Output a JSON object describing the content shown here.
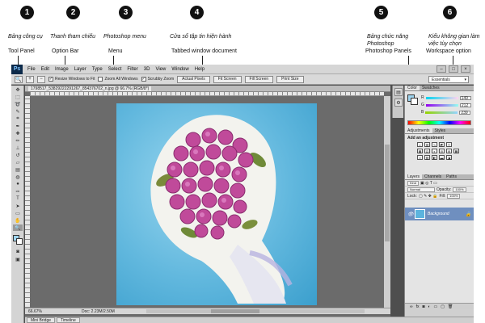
{
  "annotations": [
    {
      "number": "1",
      "vi": "Bảng công cụ",
      "en": "Tool Panel"
    },
    {
      "number": "2",
      "vi": "Thanh tham chiếu",
      "en": "Option Bar"
    },
    {
      "number": "3",
      "vi": "Photoshop menu",
      "en": "Menu"
    },
    {
      "number": "4",
      "vi": "Cửa sổ tập tin hiện hành",
      "en": "Tabbed window document"
    },
    {
      "number": "5",
      "vi": "Bảng chức năng Photoshop",
      "en": "Photoshop Panels"
    },
    {
      "number": "6",
      "vi": "Kiểu không gian làm việc tùy chọn",
      "en": "Workspace option"
    }
  ],
  "app": {
    "logo": "Ps",
    "menu": [
      "File",
      "Edit",
      "Image",
      "Layer",
      "Type",
      "Select",
      "Filter",
      "3D",
      "View",
      "Window",
      "Help"
    ],
    "window_controls": [
      "–",
      "□",
      "×"
    ]
  },
  "option_bar": {
    "zoom_tool_icon": "magnifier-icon",
    "checks": [
      {
        "label": "Resize Windows to Fit",
        "checked": true
      },
      {
        "label": "Zoom All Windows",
        "checked": false
      },
      {
        "label": "Scrubby Zoom",
        "checked": true
      }
    ],
    "buttons": [
      "Actual Pixels",
      "Fit Screen",
      "Fill Screen",
      "Print Size"
    ],
    "workspace": "Essentials"
  },
  "document": {
    "tab_title": "1798517_53829222291267_854376702_n.jpg @ 66.7% (RGB/8*)",
    "status_zoom": "66.67%",
    "status_doc": "Doc: 2.23M/2.50M"
  },
  "bottom_tabs": [
    "Mini Bridge",
    "Timeline"
  ],
  "panels": {
    "color_tabs": [
      "Color",
      "Swatches"
    ],
    "color_values": {
      "r": "149",
      "g": "212",
      "b": "239"
    },
    "adjust_tabs": [
      "Adjustments",
      "Styles"
    ],
    "adjust_title": "Add an adjustment",
    "layer_tabs": [
      "Layers",
      "Channels",
      "Paths"
    ],
    "layer_kind": "Kind",
    "blend_mode": "Normal",
    "opacity_label": "Opacity:",
    "opacity": "100%",
    "lock_label": "Lock:",
    "fill_label": "Fill:",
    "fill": "100%",
    "layer_name": "Background"
  },
  "colors": {
    "fg_color": "#9fd4ee",
    "photo_bg": "#62b8de",
    "rose": "#c04a9a"
  }
}
